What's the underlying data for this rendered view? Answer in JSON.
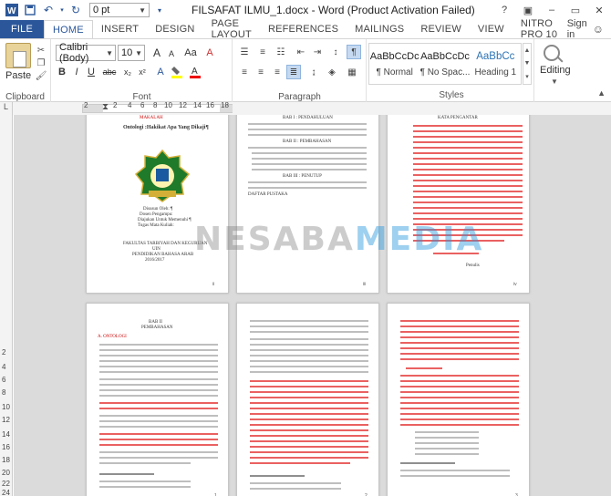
{
  "titlebar": {
    "title": "FILSAFAT ILMU_1.docx - Word (Product Activation Failed)",
    "font_size_value": "0 pt",
    "help": "?",
    "minimize": "–",
    "restore": "▭",
    "close": "✕"
  },
  "tabs": [
    "FILE",
    "HOME",
    "INSERT",
    "DESIGN",
    "PAGE LAYOUT",
    "REFERENCES",
    "MAILINGS",
    "REVIEW",
    "VIEW",
    "NITRO PRO 10"
  ],
  "active_tab": "HOME",
  "signin": "Sign in",
  "ribbon": {
    "clipboard": {
      "paste_label": "Paste",
      "group_label": "Clipboard"
    },
    "font": {
      "font_name": "Calibri (Body)",
      "font_size": "10",
      "bold": "B",
      "italic": "I",
      "underline": "U",
      "grow": "A",
      "shrink": "A",
      "case": "Aa",
      "clear": "A",
      "group_label": "Font"
    },
    "paragraph": {
      "group_label": "Paragraph",
      "pilcrow": "¶"
    },
    "styles": {
      "items": [
        {
          "preview": "AaBbCcDc",
          "name": "¶ Normal"
        },
        {
          "preview": "AaBbCcDc",
          "name": "¶ No Spac..."
        },
        {
          "preview": "AaBbCc",
          "name": "Heading 1"
        }
      ],
      "group_label": "Styles"
    },
    "editing": {
      "label": "Editing"
    }
  },
  "ruler": {
    "labels": [
      "2",
      "2",
      "4",
      "6",
      "8",
      "10",
      "12",
      "14",
      "16",
      "18"
    ]
  },
  "vruler": {
    "labels": [
      "2",
      "4",
      "6",
      "8",
      "10",
      "12",
      "14",
      "16",
      "18",
      "20",
      "22",
      "24"
    ]
  },
  "watermark": {
    "part1": "NESABA",
    "part2": "MEDIA"
  },
  "pages": {
    "p1": {
      "title": "Ontologi :Hakikat Apa Yang Dikaji¶",
      "subtitle": "MAKALAH",
      "lines": [
        "Disusun Oleh: ¶",
        "Dosen Pengampu:",
        "Diajukan Untuk Memenuhi ¶",
        "Tugas Mata Kuliah:",
        "FAKULTAS TARBIYAH DAN KEGURUAN",
        "UIN",
        "PENDIDIKAN BAHASA ARAB",
        "2016/2017"
      ],
      "page_num": "ii"
    },
    "p2": {
      "heading1": "BAB I : PENDAHULUAN",
      "heading2": "BAB II : PEMBAHASAN",
      "heading3": "BAB III : PENUTUP",
      "footer": "DAFTAR PUSTAKA",
      "page_num": "iii"
    },
    "p3": {
      "heading": "KATA PENGANTAR",
      "signature": "Penulis",
      "page_num": "iv"
    },
    "p4": {
      "heading": "BAB II",
      "subheading": "PEMBAHASAN",
      "section": "A. ONTOLOGI",
      "page_num": "1"
    },
    "p5": {
      "page_num": "2"
    },
    "p6": {
      "page_num": "3"
    }
  }
}
